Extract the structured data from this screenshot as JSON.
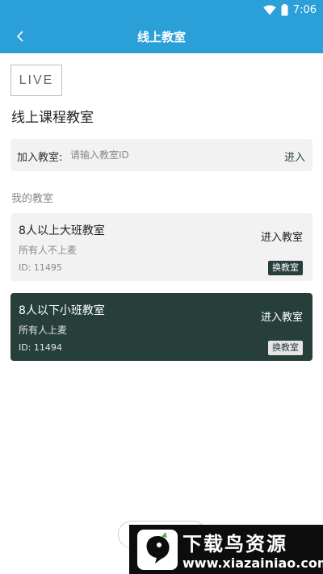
{
  "status_bar": {
    "time": "7:06"
  },
  "header": {
    "title": "线上教室"
  },
  "logo": {
    "text": "LIVE"
  },
  "page": {
    "heading": "线上课程教室"
  },
  "join": {
    "label": "加入教室:",
    "placeholder": "请输入教室ID",
    "value": "",
    "enter_label": "进入"
  },
  "my_rooms": {
    "section_label": "我的教室",
    "rooms": [
      {
        "name": "8人以上大班教室",
        "description": "所有人不上麦",
        "id_text": "ID: 11495",
        "enter_label": "进入教室",
        "switch_label": "换教室",
        "selected": false
      },
      {
        "name": "8人以下小班教室",
        "description": "所有人上麦",
        "id_text": "ID: 11494",
        "enter_label": "进入教室",
        "switch_label": "换教室",
        "selected": true
      }
    ]
  },
  "watermark": {
    "brand": "下载鸟资源",
    "url": "www.xiazainiao.com"
  },
  "colors": {
    "primary": "#2a9fd8",
    "dark_card": "#263f3b",
    "light_card": "#f2f2f2"
  }
}
